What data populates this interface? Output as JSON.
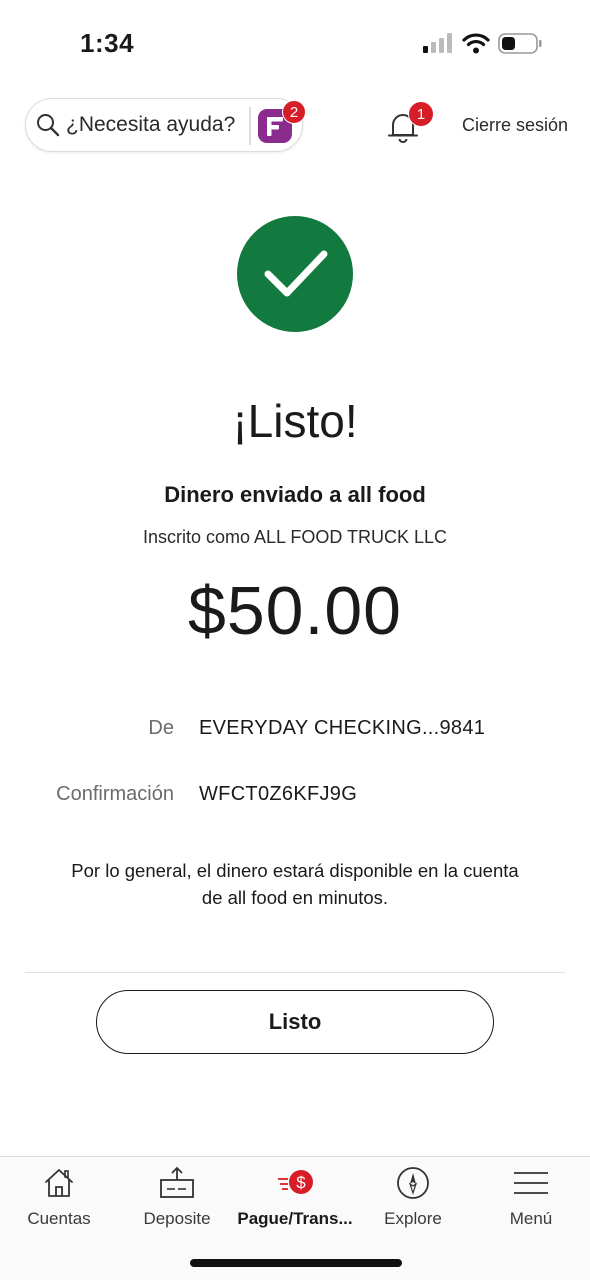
{
  "status_bar": {
    "time": "1:34"
  },
  "header": {
    "help_text": "¿Necesita ayuda?",
    "fargo_badge": "2",
    "notifications_badge": "1",
    "logout_label": "Cierre sesión"
  },
  "result": {
    "headline": "¡Listo!",
    "subhead": "Dinero enviado a all food",
    "enrolled_as": "Inscrito como ALL FOOD TRUCK LLC",
    "amount": "$50.00"
  },
  "details": {
    "from_label": "De",
    "from_value": "EVERYDAY CHECKING...9841",
    "confirmation_label": "Confirmación",
    "confirmation_value": "WFCT0Z6KFJ9G"
  },
  "note": "Por lo general, el dinero estará disponible en la cuenta de all food en minutos.",
  "done_button": "Listo",
  "nav": [
    {
      "label": "Cuentas",
      "icon": "home-icon"
    },
    {
      "label": "Deposite",
      "icon": "deposit-icon"
    },
    {
      "label": "Pague/Trans...",
      "icon": "pay-transfer-icon",
      "active": true
    },
    {
      "label": "Explore",
      "icon": "compass-icon"
    },
    {
      "label": "Menú",
      "icon": "hamburger-menu-icon"
    }
  ],
  "colors": {
    "success_green": "#127a3e",
    "badge_red": "#d71e28",
    "fargo_purple": "#8a2b8d"
  }
}
